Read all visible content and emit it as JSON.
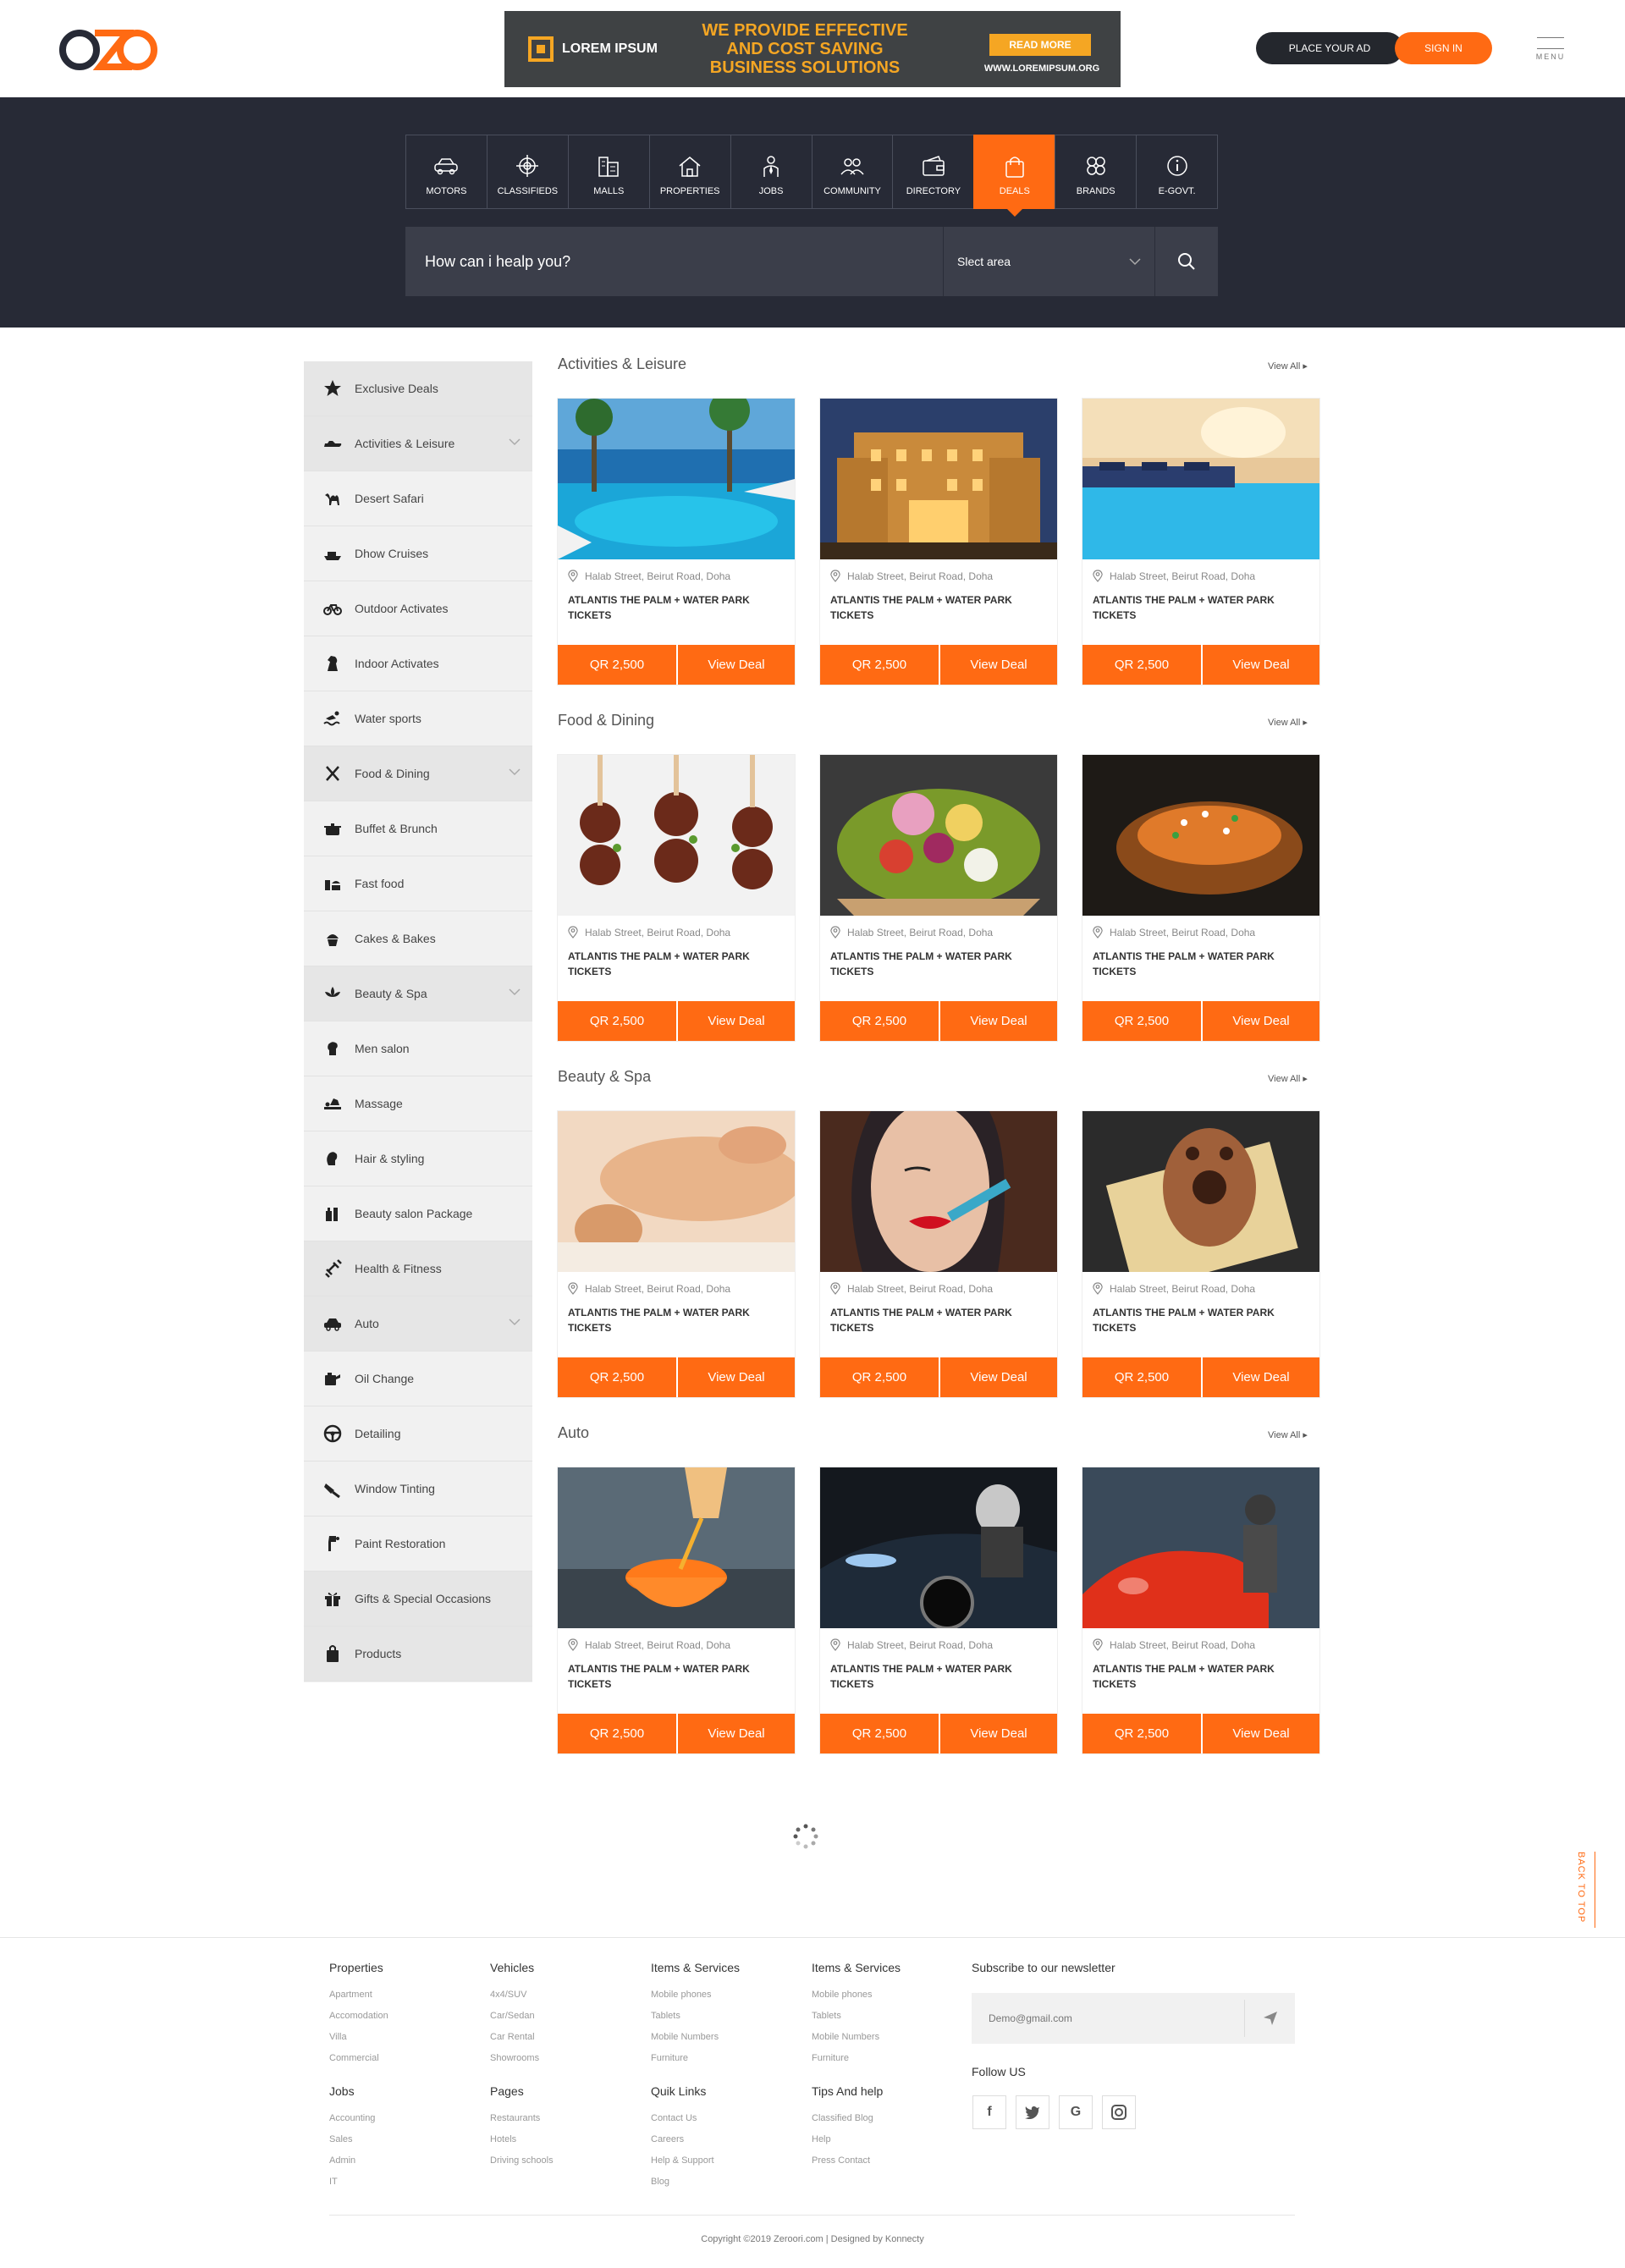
{
  "header": {
    "logo_text": "OZO",
    "ad": {
      "brand": "LOREM IPSUM",
      "headline": "WE PROVIDE EFFECTIVE AND COST SAVING BUSINESS SOLUTIONS",
      "cta": "READ MORE",
      "url": "WWW.LOREMIPSUM.ORG"
    },
    "place_ad": "PLACE YOUR AD",
    "sign_in": "SIGN IN",
    "menu": "MENU"
  },
  "categories": [
    {
      "label": "MOTORS",
      "icon": "car-icon"
    },
    {
      "label": "CLASSIFIEDS",
      "icon": "target-icon"
    },
    {
      "label": "MALLS",
      "icon": "building-icon"
    },
    {
      "label": "PROPERTIES",
      "icon": "house-icon"
    },
    {
      "label": "JOBS",
      "icon": "person-tie-icon"
    },
    {
      "label": "COMMUNITY",
      "icon": "people-icon"
    },
    {
      "label": "DIRECTORY",
      "icon": "wallet-icon"
    },
    {
      "label": "DEALS",
      "icon": "shopping-bag-icon",
      "active": true
    },
    {
      "label": "BRANDS",
      "icon": "flower-icon"
    },
    {
      "label": "E-GOVT.",
      "icon": "info-icon"
    }
  ],
  "search": {
    "placeholder": "How can i healp you?",
    "area": "Slect area"
  },
  "sidebar": {
    "items": [
      {
        "label": "Exclusive Deals",
        "icon": "star-icon",
        "group": true
      },
      {
        "label": "Activities & Leisure",
        "icon": "jetski-icon",
        "group": true,
        "expand": true
      },
      {
        "label": "Desert Safari",
        "icon": "camel-icon"
      },
      {
        "label": "Dhow Cruises",
        "icon": "boat-icon"
      },
      {
        "label": "Outdoor Activates",
        "icon": "bicycle-icon"
      },
      {
        "label": "Indoor Activates",
        "icon": "chess-knight-icon"
      },
      {
        "label": "Water sports",
        "icon": "swimmer-icon"
      },
      {
        "label": "Food & Dining",
        "icon": "fork-knife-icon",
        "group": true,
        "expand": true
      },
      {
        "label": "Buffet & Brunch",
        "icon": "pot-icon"
      },
      {
        "label": "Fast food",
        "icon": "fast-food-icon"
      },
      {
        "label": "Cakes & Bakes",
        "icon": "cupcake-icon"
      },
      {
        "label": "Beauty & Spa",
        "icon": "lotus-icon",
        "group": true,
        "expand": true
      },
      {
        "label": "Men salon",
        "icon": "man-head-icon"
      },
      {
        "label": "Massage",
        "icon": "massage-icon"
      },
      {
        "label": "Hair & styling",
        "icon": "woman-head-icon"
      },
      {
        "label": "Beauty salon Package",
        "icon": "cosmetics-icon"
      },
      {
        "label": "Health & Fitness",
        "icon": "dumbbell-icon",
        "group": true
      },
      {
        "label": "Auto",
        "icon": "car-icon",
        "group": true,
        "expand": true
      },
      {
        "label": "Oil Change",
        "icon": "oil-can-icon"
      },
      {
        "label": "Detailing",
        "icon": "steering-wheel-icon"
      },
      {
        "label": "Window Tinting",
        "icon": "spray-icon"
      },
      {
        "label": "Paint Restoration",
        "icon": "paint-gun-icon"
      },
      {
        "label": "Gifts & Special Occasions",
        "icon": "gift-icon",
        "group": true
      },
      {
        "label": "Products",
        "icon": "bag-icon",
        "group": true
      }
    ]
  },
  "sections": [
    {
      "title": "Activities & Leisure",
      "view_all": "View All",
      "cards": [
        {
          "image": "resort-pool",
          "location": "Halab Street, Beirut Road, Doha",
          "name": "ATLANTIS THE PALM + WATER PARK TICKETS",
          "price": "QR 2,500",
          "cta": "View Deal"
        },
        {
          "image": "hotel-facade",
          "location": "Halab Street, Beirut Road, Doha",
          "name": "ATLANTIS THE PALM + WATER PARK TICKETS",
          "price": "QR 2,500",
          "cta": "View Deal"
        },
        {
          "image": "night-pool",
          "location": "Halab Street, Beirut Road, Doha",
          "name": "ATLANTIS THE PALM + WATER PARK TICKETS",
          "price": "QR 2,500",
          "cta": "View Deal"
        }
      ]
    },
    {
      "title": "Food & Dining",
      "view_all": "View All",
      "cards": [
        {
          "image": "meat-skewers",
          "location": "Halab Street, Beirut Road, Doha",
          "name": "ATLANTIS THE PALM + WATER PARK TICKETS",
          "price": "QR 2,500",
          "cta": "View Deal"
        },
        {
          "image": "salad-bowl",
          "location": "Halab Street, Beirut Road, Doha",
          "name": "ATLANTIS THE PALM + WATER PARK TICKETS",
          "price": "QR 2,500",
          "cta": "View Deal"
        },
        {
          "image": "stuffed-potato",
          "location": "Halab Street, Beirut Road, Doha",
          "name": "ATLANTIS THE PALM + WATER PARK TICKETS",
          "price": "QR 2,500",
          "cta": "View Deal"
        }
      ]
    },
    {
      "title": "Beauty & Spa",
      "view_all": "View All",
      "cards": [
        {
          "image": "massage",
          "location": "Halab Street, Beirut Road, Doha",
          "name": "ATLANTIS THE PALM + WATER PARK TICKETS",
          "price": "QR 2,500",
          "cta": "View Deal"
        },
        {
          "image": "lipstick",
          "location": "Halab Street, Beirut Road, Doha",
          "name": "ATLANTIS THE PALM + WATER PARK TICKETS",
          "price": "QR 2,500",
          "cta": "View Deal"
        },
        {
          "image": "henna",
          "location": "Halab Street, Beirut Road, Doha",
          "name": "ATLANTIS THE PALM + WATER PARK TICKETS",
          "price": "QR 2,500",
          "cta": "View Deal"
        }
      ]
    },
    {
      "title": "Auto",
      "view_all": "View All",
      "cards": [
        {
          "image": "oil-pour",
          "location": "Halab Street, Beirut Road, Doha",
          "name": "ATLANTIS THE PALM + WATER PARK TICKETS",
          "price": "QR 2,500",
          "cta": "View Deal"
        },
        {
          "image": "car-polish",
          "location": "Halab Street, Beirut Road, Doha",
          "name": "ATLANTIS THE PALM + WATER PARK TICKETS",
          "price": "QR 2,500",
          "cta": "View Deal"
        },
        {
          "image": "car-paint",
          "location": "Halab Street, Beirut Road, Doha",
          "name": "ATLANTIS THE PALM + WATER PARK TICKETS",
          "price": "QR 2,500",
          "cta": "View Deal"
        }
      ]
    }
  ],
  "back_to_top": "BACK TO TOP",
  "footer": {
    "columns": [
      {
        "title": "Properties",
        "links": [
          "Apartment",
          "Accomodation",
          "Villa",
          "Commercial"
        ]
      },
      {
        "title": "Vehicles",
        "links": [
          "4x4/SUV",
          "Car/Sedan",
          "Car Rental",
          "Showrooms"
        ]
      },
      {
        "title": "Items & Services",
        "links": [
          "Mobile phones",
          "Tablets",
          "Mobile Numbers",
          "Furniture"
        ]
      },
      {
        "title": "Items & Services",
        "links": [
          "Mobile phones",
          "Tablets",
          "Mobile Numbers",
          "Furniture"
        ]
      },
      {
        "title": "Jobs",
        "links": [
          "Accounting",
          "Sales",
          "Admin",
          "IT"
        ]
      },
      {
        "title": "Pages",
        "links": [
          "Restaurants",
          "Hotels",
          "Driving schools"
        ]
      },
      {
        "title": "Quik Links",
        "links": [
          "Contact Us",
          "Careers",
          "Help & Support",
          "Blog"
        ]
      },
      {
        "title": "Tips And help",
        "links": [
          "Classified Blog",
          "Help",
          "Press Contact"
        ]
      }
    ],
    "newsletter_title": "Subscribe to our newsletter",
    "newsletter_placeholder": "Demo@gmail.com",
    "follow_title": "Follow US",
    "social": [
      "f",
      "t",
      "G",
      "ig"
    ],
    "copyright": "Copyright ©2019 Zeroori.com  |  Designed by Konnecty"
  },
  "colors": {
    "accent": "#ff6a13",
    "dark": "#272a36",
    "sidebar": "#f1f1f1"
  }
}
